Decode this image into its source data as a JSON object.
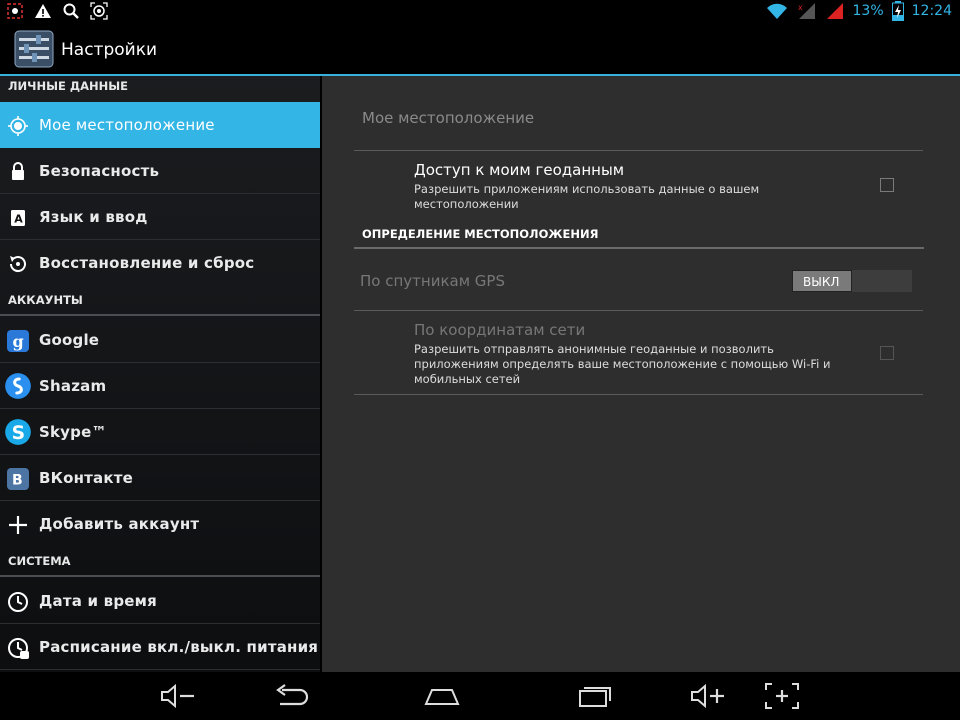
{
  "status_bar": {
    "battery": "13%",
    "time": "12:24",
    "left_icons": [
      "screenshot-icon",
      "warning-icon",
      "search-icon",
      "location-target-icon"
    ],
    "right_icons": [
      "wifi-icon",
      "signal-icon",
      "signal-icon-2",
      "battery-charging-icon"
    ]
  },
  "action_bar": {
    "title": "Настройки",
    "icon": "settings-app-icon"
  },
  "sidebar": {
    "sections": [
      {
        "header": "ЛИЧНЫЕ ДАННЫЕ"
      },
      {
        "header": "АККАУНТЫ"
      },
      {
        "header": "СИСТЕМА"
      }
    ],
    "items": [
      {
        "label": "Мое местоположение",
        "icon": "location-icon",
        "active": true
      },
      {
        "label": "Безопасность",
        "icon": "lock-icon"
      },
      {
        "label": "Язык и ввод",
        "icon": "keyboard-a-icon"
      },
      {
        "label": "Восстановление и сброс",
        "icon": "restore-icon"
      },
      {
        "label": "Google",
        "icon": "google-icon"
      },
      {
        "label": "Shazam",
        "icon": "shazam-icon"
      },
      {
        "label": "Skype™",
        "icon": "skype-icon"
      },
      {
        "label": "ВКонтакте",
        "icon": "vk-icon"
      },
      {
        "label": "Добавить аккаунт",
        "icon": "plus-icon"
      },
      {
        "label": "Дата и время",
        "icon": "clock-icon"
      },
      {
        "label": "Расписание вкл./выкл. питания",
        "icon": "power-schedule-icon"
      }
    ]
  },
  "content": {
    "title": "Мое местоположение",
    "geo_access": {
      "title": "Доступ к моим геоданным",
      "summary": "Разрешить приложениям использовать данные о вашем местоположении",
      "checked": false
    },
    "category": "ОПРЕДЕЛЕНИЕ МЕСТОПОЛОЖЕНИЯ",
    "gps": {
      "title": "По спутникам GPS",
      "toggle_label": "ВЫКЛ",
      "enabled": false
    },
    "network": {
      "title": "По координатам сети",
      "summary": "Разрешить отправлять анонимные геоданные и позволить приложениям определять ваше местоположение с помощью Wi-Fi и мобильных сетей",
      "checked": false
    }
  },
  "nav_bar": {
    "buttons": [
      "volume-down-icon",
      "back-icon",
      "home-icon",
      "recent-apps-icon",
      "volume-up-icon",
      "screenshot-capture-icon"
    ]
  },
  "colors": {
    "accent": "#33b5e5",
    "background": "#000000",
    "content_bg": "#2e2e2e"
  }
}
